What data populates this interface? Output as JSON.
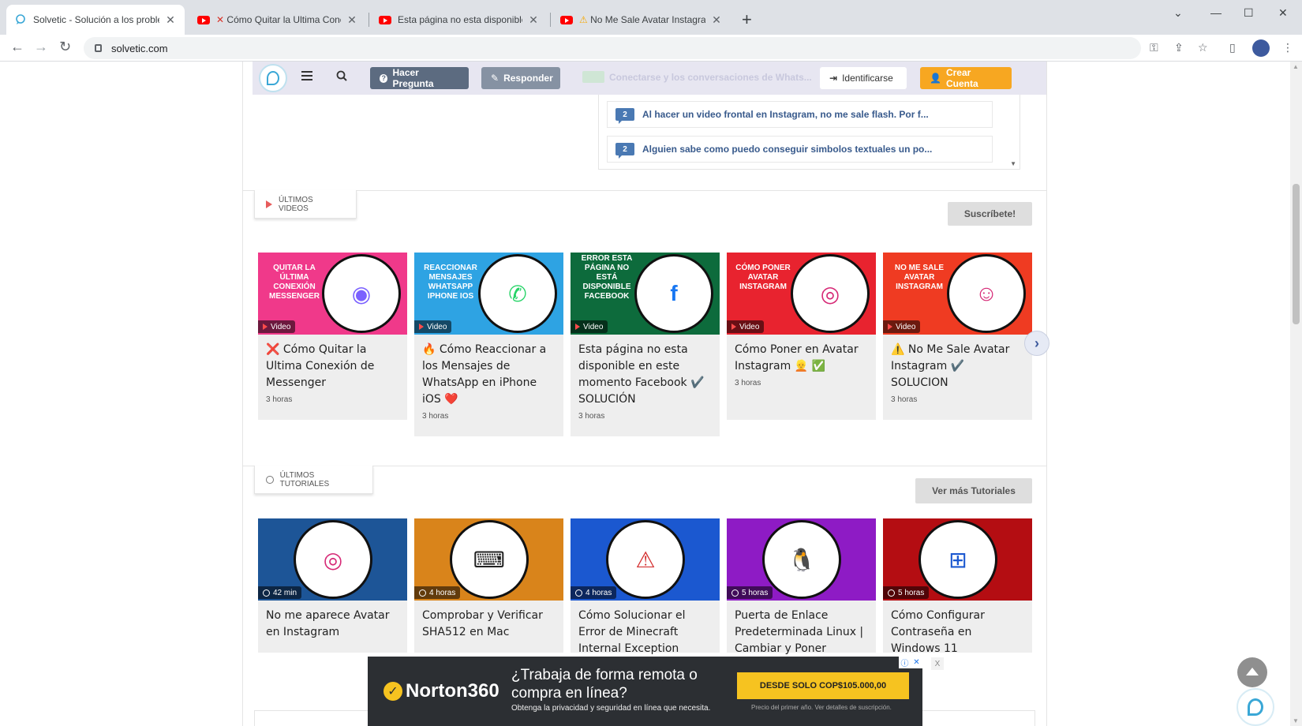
{
  "browser": {
    "tabs": [
      {
        "title": "Solvetic - Solución a los problem",
        "active": true
      },
      {
        "title": "Cómo Quitar la Ultima Conex",
        "prefix": "❌"
      },
      {
        "title": "Esta página no esta disponible e"
      },
      {
        "title": "No Me Sale Avatar Instagram",
        "prefix": "⚠️"
      }
    ],
    "url": "solvetic.com"
  },
  "header": {
    "ask_label": "Hacer Pregunta",
    "answer_label": "Responder",
    "login_label": "Identificarse",
    "signup_label": "Crear Cuenta",
    "faded_text": "Conectarse y los conversaciones de Whats..."
  },
  "questions": [
    {
      "count": "2",
      "text": "Al hacer un video frontal en Instagram, no me sale flash. Por f..."
    },
    {
      "count": "2",
      "text": "Alguien sabe como puedo conseguir simbolos textuales un po..."
    }
  ],
  "videos_section": {
    "title": "ÚLTIMOS VIDEOS",
    "subscribe_label": "Suscríbete!",
    "badge_label": "Video",
    "items": [
      {
        "thumb_text": "QUITAR LA ÚLTIMA CONEXIÓN MESSENGER",
        "title": "❌ Cómo Quitar la Ultima Conexión de Messenger",
        "time": "3 horas"
      },
      {
        "thumb_text": "REACCIONAR MENSAJES WHATSAPP IPHONE IOS",
        "title": "🔥 Cómo Reaccionar a los Mensajes de WhatsApp en iPhone iOS ❤️",
        "time": "3 horas"
      },
      {
        "thumb_text": "ERROR ESTA PÁGINA NO ESTÁ DISPONIBLE FACEBOOK",
        "title": "Esta página no esta disponible en este momento Facebook ✔️ SOLUCIÓN",
        "time": "3 horas"
      },
      {
        "thumb_text": "CÓMO PONER AVATAR INSTAGRAM",
        "title": "Cómo Poner en Avatar Instagram 👱 ✅",
        "time": "3 horas"
      },
      {
        "thumb_text": "NO ME SALE AVATAR INSTAGRAM",
        "title": "⚠️ No Me Sale Avatar Instagram ✔️ SOLUCION",
        "time": "3 horas"
      }
    ]
  },
  "tutorials_section": {
    "title": "ÚLTIMOS TUTORIALES",
    "more_label": "Ver más Tutoriales",
    "items": [
      {
        "title": "No me aparece Avatar en Instagram",
        "time": "42 min"
      },
      {
        "title": "Comprobar y Verificar SHA512 en Mac",
        "time": "4 horas"
      },
      {
        "title": "Cómo Solucionar el Error de Minecraft Internal Exception",
        "time": "4 horas"
      },
      {
        "title": "Puerta de Enlace Predeterminada Linux | Cambiar y Poner",
        "time": "5 horas"
      },
      {
        "title": "Cómo Configurar Contraseña en Windows 11",
        "time": "5 horas"
      }
    ]
  },
  "ad": {
    "brand": "Norton360",
    "headline": "¿Trabaja de forma remota o compra en línea?",
    "subline": "Obtenga la privacidad y seguridad en línea que necesita.",
    "cta": "DESDE SOLO COP$105.000,00",
    "fine_print": "Precio del primer año. Ver detalles de suscripción.",
    "close_label": "X"
  },
  "colors": {
    "thumb_pink": "#f0398a",
    "thumb_blue": "#2ea3e3",
    "thumb_green": "#0d6b3c",
    "thumb_red": "#e8232f",
    "thumb_orange": "#ef3b22",
    "tut_navy": "#1d5597",
    "tut_orange": "#d9841b",
    "tut_blue": "#1b58d0",
    "tut_purple": "#8e1bc5",
    "tut_darkred": "#b40d12"
  }
}
